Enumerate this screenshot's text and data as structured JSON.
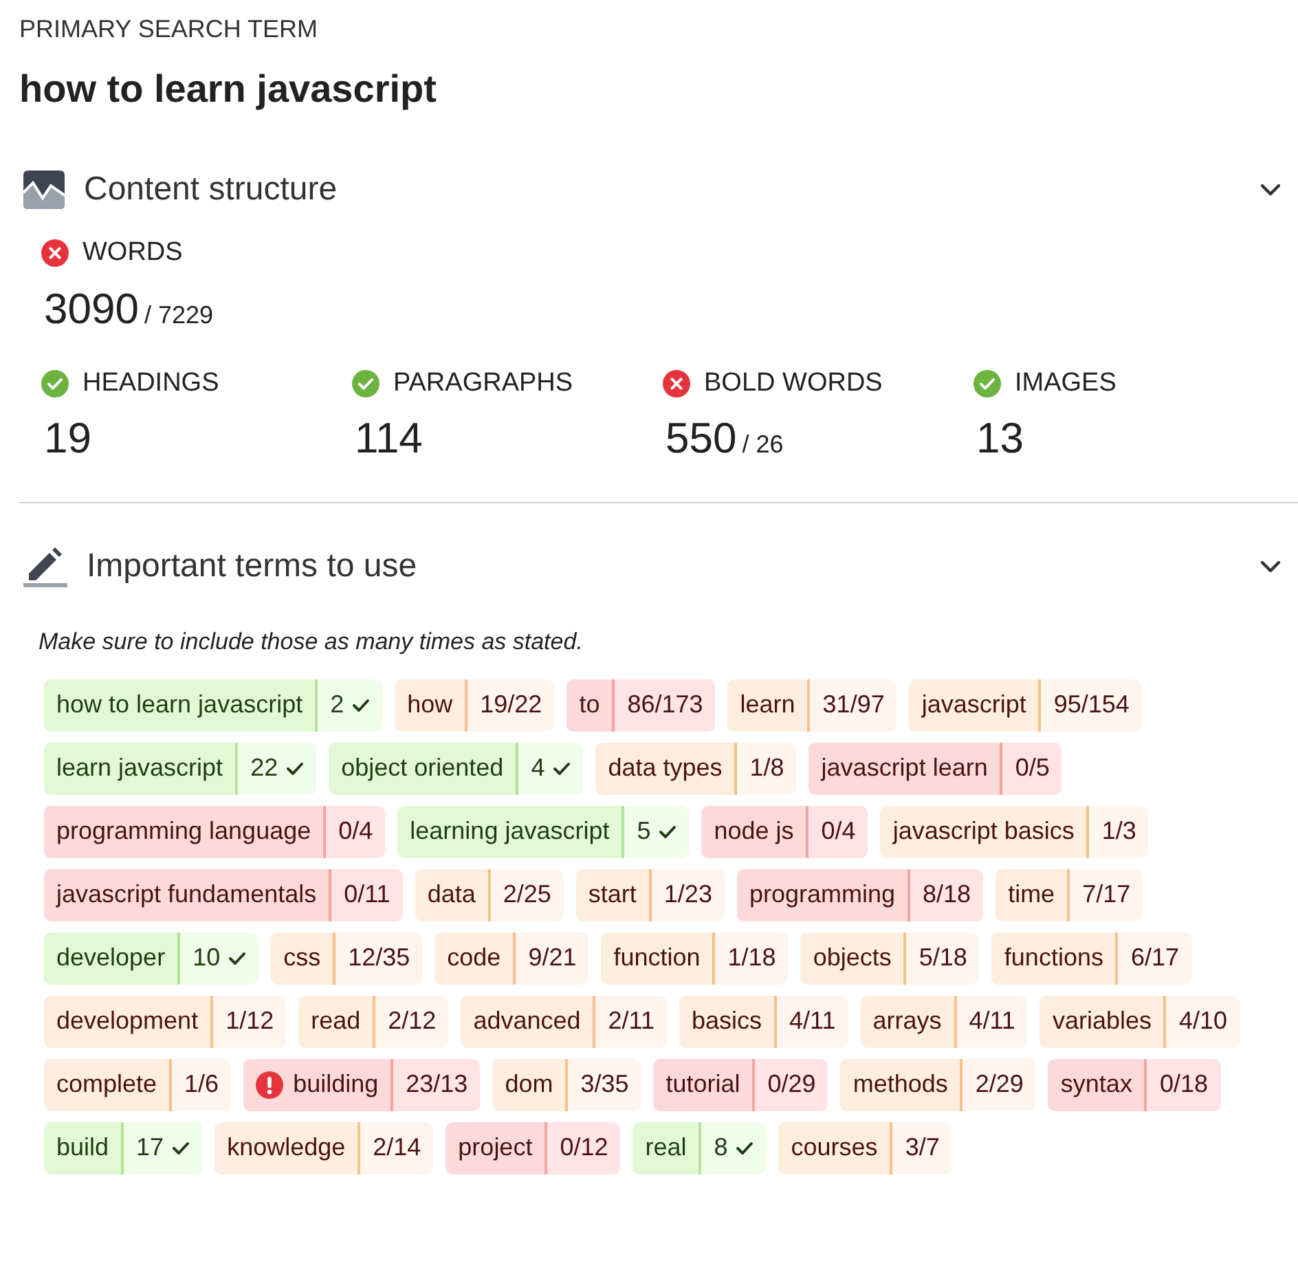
{
  "primary": {
    "label": "PRIMARY SEARCH TERM",
    "term": "how to learn javascript"
  },
  "structure": {
    "title": "Content structure",
    "expanded": true,
    "words": {
      "label": "WORDS",
      "ok": false,
      "value": "3090",
      "target": "/ 7229"
    },
    "metrics": [
      {
        "label": "HEADINGS",
        "ok": true,
        "value": "19"
      },
      {
        "label": "PARAGRAPHS",
        "ok": true,
        "value": "114"
      },
      {
        "label": "BOLD WORDS",
        "ok": false,
        "value": "550",
        "target": "/ 26"
      },
      {
        "label": "IMAGES",
        "ok": true,
        "value": "13"
      }
    ]
  },
  "terms": {
    "title": "Important terms to use",
    "expanded": true,
    "hint": "Make sure to include those as many times as stated.",
    "items": [
      {
        "term": "how to learn javascript",
        "count": "2",
        "kind": "done"
      },
      {
        "term": "how",
        "count": "19/22",
        "kind": "partial"
      },
      {
        "term": "to",
        "count": "86/173",
        "kind": "missing"
      },
      {
        "term": "learn",
        "count": "31/97",
        "kind": "partial"
      },
      {
        "term": "javascript",
        "count": "95/154",
        "kind": "partial"
      },
      {
        "term": "learn javascript",
        "count": "22",
        "kind": "done"
      },
      {
        "term": "object oriented",
        "count": "4",
        "kind": "done"
      },
      {
        "term": "data types",
        "count": "1/8",
        "kind": "partial"
      },
      {
        "term": "javascript learn",
        "count": "0/5",
        "kind": "missing"
      },
      {
        "term": "programming language",
        "count": "0/4",
        "kind": "missing"
      },
      {
        "term": "learning javascript",
        "count": "5",
        "kind": "done"
      },
      {
        "term": "node js",
        "count": "0/4",
        "kind": "missing"
      },
      {
        "term": "javascript basics",
        "count": "1/3",
        "kind": "partial"
      },
      {
        "term": "javascript fundamentals",
        "count": "0/11",
        "kind": "missing"
      },
      {
        "term": "data",
        "count": "2/25",
        "kind": "partial"
      },
      {
        "term": "start",
        "count": "1/23",
        "kind": "partial"
      },
      {
        "term": "programming",
        "count": "8/18",
        "kind": "missing"
      },
      {
        "term": "time",
        "count": "7/17",
        "kind": "partial"
      },
      {
        "term": "developer",
        "count": "10",
        "kind": "done"
      },
      {
        "term": "css",
        "count": "12/35",
        "kind": "partial"
      },
      {
        "term": "code",
        "count": "9/21",
        "kind": "partial"
      },
      {
        "term": "function",
        "count": "1/18",
        "kind": "partial"
      },
      {
        "term": "objects",
        "count": "5/18",
        "kind": "partial"
      },
      {
        "term": "functions",
        "count": "6/17",
        "kind": "partial"
      },
      {
        "term": "development",
        "count": "1/12",
        "kind": "partial"
      },
      {
        "term": "read",
        "count": "2/12",
        "kind": "partial"
      },
      {
        "term": "advanced",
        "count": "2/11",
        "kind": "partial"
      },
      {
        "term": "basics",
        "count": "4/11",
        "kind": "partial"
      },
      {
        "term": "arrays",
        "count": "4/11",
        "kind": "partial"
      },
      {
        "term": "variables",
        "count": "4/10",
        "kind": "partial"
      },
      {
        "term": "complete",
        "count": "1/6",
        "kind": "partial"
      },
      {
        "term": "building",
        "count": "23/13",
        "kind": "over"
      },
      {
        "term": "dom",
        "count": "3/35",
        "kind": "partial"
      },
      {
        "term": "tutorial",
        "count": "0/29",
        "kind": "missing"
      },
      {
        "term": "methods",
        "count": "2/29",
        "kind": "partial"
      },
      {
        "term": "syntax",
        "count": "0/18",
        "kind": "missing"
      },
      {
        "term": "build",
        "count": "17",
        "kind": "done"
      },
      {
        "term": "knowledge",
        "count": "2/14",
        "kind": "partial"
      },
      {
        "term": "project",
        "count": "0/12",
        "kind": "missing"
      },
      {
        "term": "real",
        "count": "8",
        "kind": "done"
      },
      {
        "term": "courses",
        "count": "3/7",
        "kind": "partial"
      }
    ]
  }
}
